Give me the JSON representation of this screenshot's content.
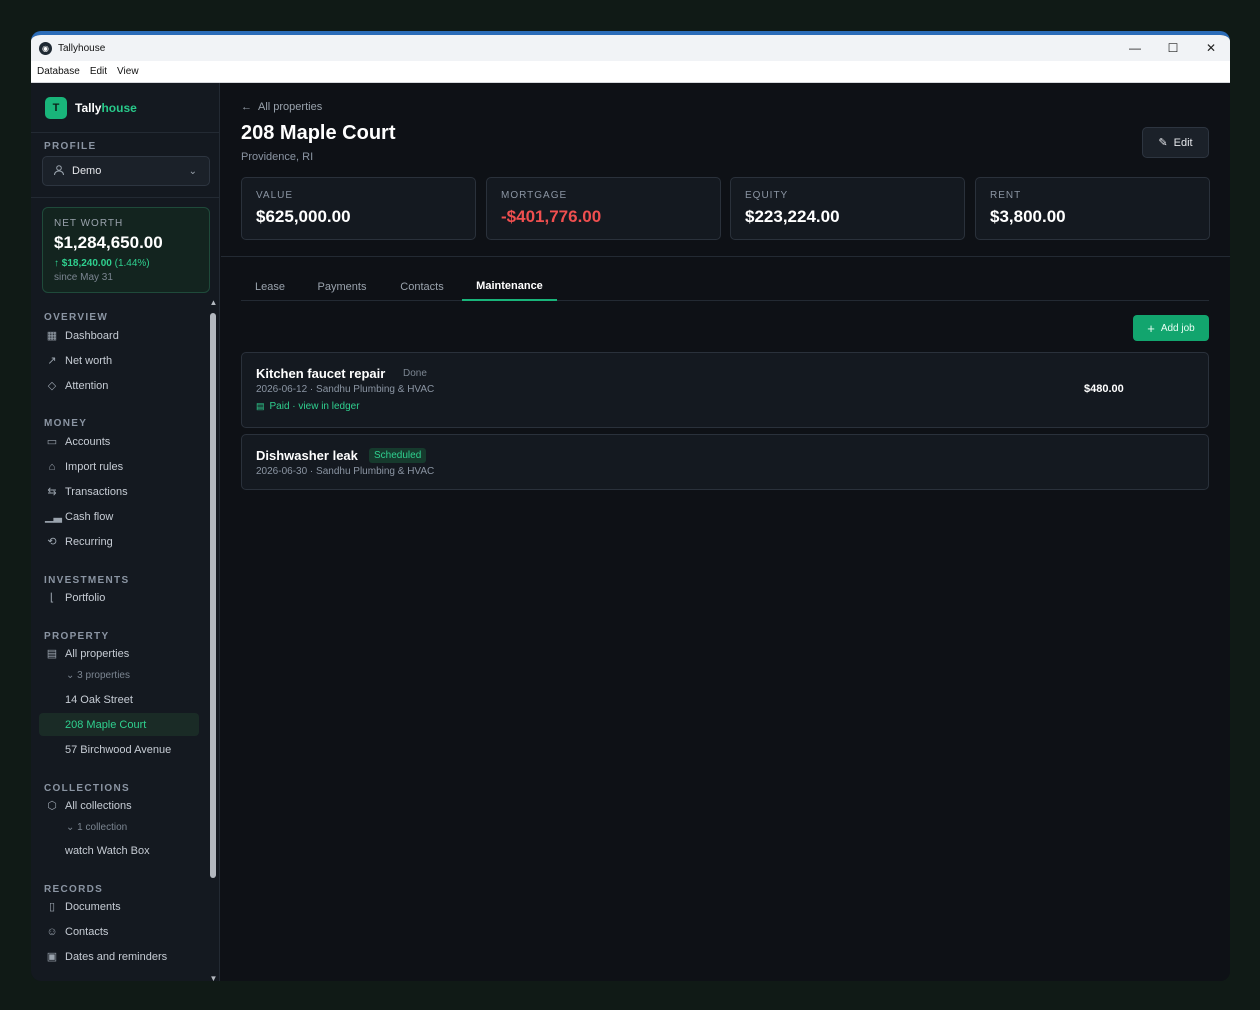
{
  "window": {
    "title": "Tallyhouse",
    "controls": {
      "minimize": "—",
      "maximize": "☐",
      "close": "✕"
    }
  },
  "menu": [
    "Database",
    "Edit",
    "View"
  ],
  "brand": {
    "logo_letter": "T",
    "name_part1": "Tally",
    "name_part2": "house",
    "accent_color": "#28c98a"
  },
  "profile": {
    "label": "PROFILE",
    "selected": "Demo"
  },
  "net_worth": {
    "label": "NET WORTH",
    "value": "$1,284,650.00",
    "change_amount": "↑ $18,240.00",
    "change_pct": "(1.44%)",
    "since": "since May 31"
  },
  "nav": {
    "overview": {
      "label": "OVERVIEW",
      "items": [
        "Dashboard",
        "Net worth",
        "Attention"
      ]
    },
    "money": {
      "label": "MONEY",
      "items": [
        "Accounts",
        "Import rules",
        "Transactions",
        "Cash flow",
        "Recurring"
      ]
    },
    "investments": {
      "label": "INVESTMENTS",
      "items": [
        "Portfolio"
      ]
    },
    "property": {
      "label": "PROPERTY",
      "all": "All properties",
      "count": "3 properties",
      "children": [
        "14 Oak Street",
        "208 Maple Court",
        "57 Birchwood Avenue"
      ],
      "active": "208 Maple Court"
    },
    "collections": {
      "label": "COLLECTIONS",
      "all": "All collections",
      "count": "1 collection",
      "children": [
        "watch  Watch Box"
      ]
    },
    "records": {
      "label": "RECORDS",
      "items": [
        "Documents",
        "Contacts",
        "Dates and reminders"
      ]
    }
  },
  "page": {
    "back_label": "All properties",
    "title": "208 Maple Court",
    "subtitle": "Providence, RI",
    "edit_label": "Edit"
  },
  "stats": [
    {
      "label": "VALUE",
      "value": "$625,000.00",
      "negative": false
    },
    {
      "label": "MORTGAGE",
      "value": "-$401,776.00",
      "negative": true
    },
    {
      "label": "EQUITY",
      "value": "$223,224.00",
      "negative": false
    },
    {
      "label": "RENT",
      "value": "$3,800.00",
      "negative": false
    }
  ],
  "tabs": [
    "Lease",
    "Payments",
    "Contacts",
    "Maintenance"
  ],
  "active_tab": "Maintenance",
  "add_job_label": "Add job",
  "jobs": [
    {
      "title": "Kitchen faucet repair",
      "status": "Done",
      "meta": "2026-06-12 · Sandhu Plumbing & HVAC",
      "ledger": "Paid · view in ledger",
      "amount": "$480.00"
    },
    {
      "title": "Dishwasher leak",
      "status": "Scheduled",
      "meta": "2026-06-30 · Sandhu Plumbing & HVAC"
    }
  ]
}
